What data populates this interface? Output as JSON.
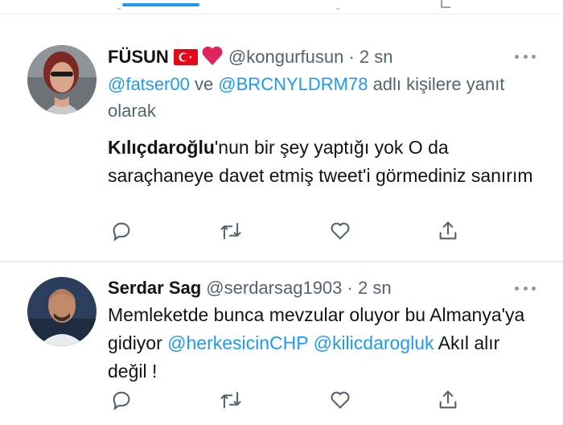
{
  "tweets": [
    {
      "name": "FÜSUN",
      "handle": "@kongurfusun",
      "separator": "·",
      "time": "2 sn",
      "reply_to": {
        "mention1": "@fatser00",
        "joiner": " ve ",
        "mention2": "@BRCNYLDRM78",
        "suffix": " adlı kişilere yanıt olarak"
      },
      "body": {
        "bold": "Kılıçdaroğlu",
        "rest": "'nun bir şey yaptığı yok O da saraçhaneye davet etmiş tweet'i görmediniz sanırım"
      }
    },
    {
      "name": "Serdar Sag",
      "handle": "@serdarsag1903",
      "separator": "·",
      "time": "2 sn",
      "body": {
        "text1": "Memleketde bunca mevzular oluyor bu Almanya'ya gidiyor ",
        "link1": "@herkesicinCHP",
        "space": " ",
        "link2": "@kilicdarogluk",
        "text2": " Akıl alır değil !"
      }
    }
  ],
  "icons": [
    "reply-icon",
    "retweet-icon",
    "like-icon",
    "share-icon",
    "more-icon",
    "turkey-flag-icon",
    "red-heart-icon"
  ],
  "colors": {
    "accent": "#1d9bf0",
    "secondary_text": "#536471",
    "text": "#0f1419",
    "divider": "#e6ecf0",
    "heart": "#e0245e",
    "flag": "#e30a17"
  }
}
